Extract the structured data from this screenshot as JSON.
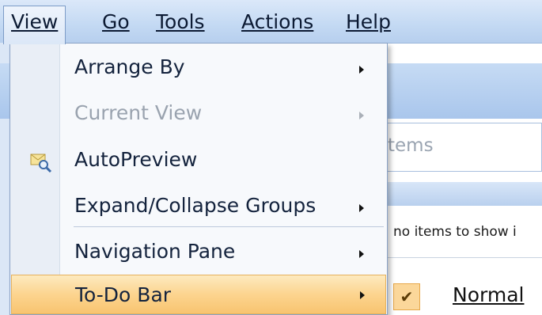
{
  "menubar": {
    "items": [
      {
        "label": "View",
        "accel": "V"
      },
      {
        "label": "Go",
        "accel": "G"
      },
      {
        "label": "Tools",
        "accel": "T"
      },
      {
        "label": "Actions",
        "accel": "A"
      },
      {
        "label": "Help",
        "accel": "H"
      }
    ]
  },
  "view_menu": {
    "items": [
      {
        "label": "Arrange By",
        "has_submenu": true,
        "enabled": true
      },
      {
        "label": "Current View",
        "has_submenu": true,
        "enabled": false
      },
      {
        "label": "AutoPreview",
        "has_submenu": false,
        "enabled": true,
        "icon": "autopreview-icon"
      },
      {
        "label": "Expand/Collapse Groups",
        "has_submenu": true,
        "enabled": true
      },
      {
        "label": "Navigation Pane",
        "has_submenu": true,
        "enabled": true
      },
      {
        "label": "To-Do Bar",
        "has_submenu": true,
        "enabled": true,
        "highlighted": true
      }
    ]
  },
  "background": {
    "search_placeholder_fragment": "tems",
    "empty_message_fragment": "no items to show i",
    "submenu_first_item": {
      "label": "Normal",
      "checked": true
    }
  },
  "colors": {
    "menubar": "#c3d9f3",
    "highlight": "#fcd48f",
    "menu_bg": "#f7f9fc"
  }
}
